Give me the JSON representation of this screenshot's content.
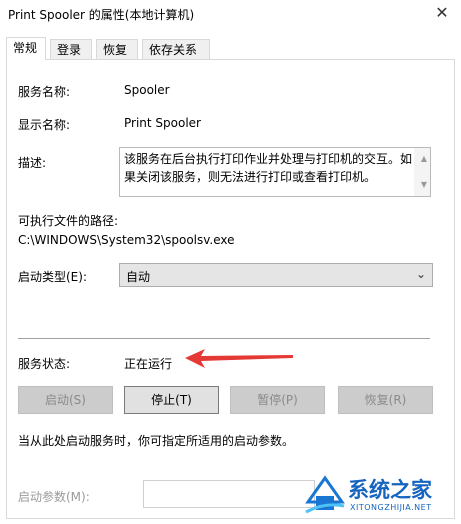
{
  "window": {
    "title": "Print Spooler 的属性(本地计算机)",
    "close_glyph": "✕"
  },
  "tabs": [
    {
      "label": "常规"
    },
    {
      "label": "登录"
    },
    {
      "label": "恢复"
    },
    {
      "label": "依存关系"
    }
  ],
  "general": {
    "service_name_label": "服务名称:",
    "service_name_value": "Spooler",
    "display_name_label": "显示名称:",
    "display_name_value": "Print Spooler",
    "description_label": "描述:",
    "description_value": "该服务在后台执行打印作业并处理与打印机的交互。如果关闭该服务，则无法进行打印或查看打印机。",
    "exe_path_label": "可执行文件的路径:",
    "exe_path_value": "C:\\WINDOWS\\System32\\spoolsv.exe",
    "startup_type_label": "启动类型(E):",
    "startup_type_value": "自动",
    "status_label": "服务状态:",
    "status_value": "正在运行",
    "buttons": {
      "start": "启动(S)",
      "stop": "停止(T)",
      "pause": "暂停(P)",
      "resume": "恢复(R)"
    },
    "hint": "当从此处启动服务时，你可指定所适用的启动参数。",
    "params_label": "启动参数(M):"
  },
  "watermark": {
    "text_cn": "系统之家",
    "text_en": "XITONGZHIJIA.NET"
  },
  "colors": {
    "arrow": "#e53935",
    "logo_blue": "#1976d2"
  }
}
